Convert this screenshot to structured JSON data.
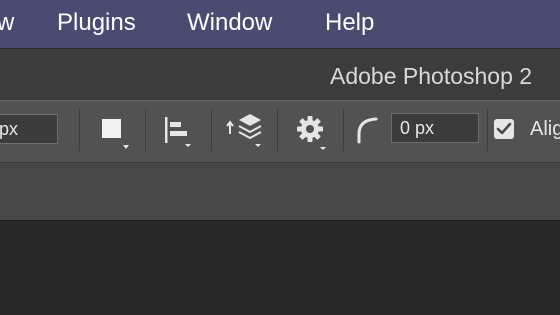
{
  "menubar": {
    "items": [
      "w",
      "Plugins",
      "Window",
      "Help"
    ]
  },
  "titlebar": {
    "title": "Adobe Photoshop 2"
  },
  "options_bar": {
    "width_field_value": "px",
    "radius_field_value": "0 px",
    "align_edges_checked": true,
    "align_edges_label": "Alig",
    "icons": [
      "fill-swatch-icon",
      "path-alignment-icon",
      "path-arrangement-icon",
      "settings-gear-icon",
      "corner-radius-icon",
      "checkbox-icon"
    ]
  },
  "colors": {
    "menubar_bg": "#4a4b70",
    "titlebar_bg": "#3c3c3c",
    "options_bar_bg": "#525252",
    "workspace_bg": "#282828"
  }
}
